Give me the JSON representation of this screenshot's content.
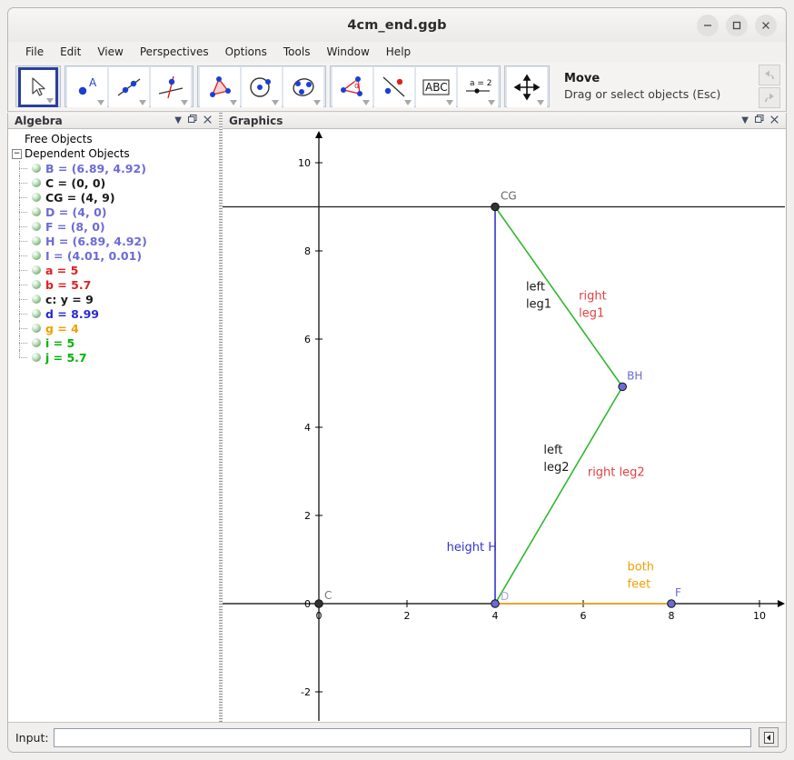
{
  "window": {
    "title": "4cm_end.ggb",
    "minimize_icon": "minimize-icon",
    "maximize_icon": "maximize-icon",
    "close_icon": "close-icon"
  },
  "menu": {
    "items": [
      {
        "label": "File"
      },
      {
        "label": "Edit"
      },
      {
        "label": "View"
      },
      {
        "label": "Perspectives"
      },
      {
        "label": "Options"
      },
      {
        "label": "Tools"
      },
      {
        "label": "Window"
      },
      {
        "label": "Help"
      }
    ]
  },
  "toolbar": {
    "tools": [
      {
        "name": "move-tool",
        "icon": "arrow-cursor-icon",
        "selected": true
      },
      {
        "name": "point-tool",
        "icon": "point-a-icon",
        "selected": false
      },
      {
        "name": "line-tool",
        "icon": "line-through-two-points-icon",
        "selected": false
      },
      {
        "name": "perpendicular-line-tool",
        "icon": "perpendicular-line-icon",
        "selected": false
      },
      {
        "name": "polygon-tool",
        "icon": "triangle-polygon-icon",
        "selected": false
      },
      {
        "name": "circle-tool",
        "icon": "circle-center-point-icon",
        "selected": false
      },
      {
        "name": "conic-tool",
        "icon": "ellipse-three-points-icon",
        "selected": false
      },
      {
        "name": "angle-tool",
        "icon": "angle-measure-icon",
        "selected": false
      },
      {
        "name": "reflect-tool",
        "icon": "reflect-about-line-icon",
        "selected": false
      },
      {
        "name": "text-tool",
        "icon": "abc-text-icon",
        "selected": false
      },
      {
        "name": "slider-tool",
        "icon": "slider-a-equals-2-icon",
        "selected": false
      },
      {
        "name": "move-graphics-tool",
        "icon": "move-graphics-view-icon",
        "selected": false
      }
    ],
    "active_tool_name": "Move",
    "active_tool_hint": "Drag or select objects (Esc)",
    "undo_icon": "undo-arrow-icon",
    "redo_icon": "redo-arrow-icon"
  },
  "algebra_panel": {
    "title": "Algebra",
    "header_icons": [
      "chevron-down-icon",
      "restore-icon",
      "close-icon"
    ],
    "groups": [
      {
        "label": "Free Objects",
        "expandable": false,
        "children": []
      },
      {
        "label": "Dependent Objects",
        "expandable": true,
        "expander_glyph": "−",
        "children": [
          {
            "text": "B = (6.89, 4.92)",
            "color": "#6b6bd6"
          },
          {
            "text": "C = (0, 0)",
            "color": "#1a1a1a"
          },
          {
            "text": "CG = (4, 9)",
            "color": "#1a1a1a"
          },
          {
            "text": "D = (4, 0)",
            "color": "#6b6bd6"
          },
          {
            "text": "F = (8, 0)",
            "color": "#6b6bd6"
          },
          {
            "text": "H = (6.89, 4.92)",
            "color": "#6b6bd6"
          },
          {
            "text": "I = (4.01, 0.01)",
            "color": "#6b6bd6"
          },
          {
            "text": "a = 5",
            "color": "#e02020"
          },
          {
            "text": "b = 5.7",
            "color": "#e02020"
          },
          {
            "text": "c: y = 9",
            "color": "#1a1a1a"
          },
          {
            "text": "d = 8.99",
            "color": "#2a2ad0"
          },
          {
            "text": "g = 4",
            "color": "#f0a000"
          },
          {
            "text": "i = 5",
            "color": "#00b400"
          },
          {
            "text": "j = 5.7",
            "color": "#00b400"
          }
        ]
      }
    ]
  },
  "graphics_panel": {
    "title": "Graphics",
    "header_icons": [
      "chevron-down-icon",
      "restore-icon",
      "close-icon"
    ]
  },
  "input_bar": {
    "label": "Input:",
    "value": "",
    "placeholder": "",
    "side_button_icon": "collapse-left-icon"
  },
  "colors": {
    "green_segment": "#2eb82e",
    "blue_segment": "#3333cc",
    "orange_segment": "#f0a000",
    "red_label": "#e04040",
    "black_label": "#1a1a1a",
    "point_blue": "#6b6bd6",
    "point_black": "#333333",
    "axis": "#000000"
  },
  "chart_data": {
    "type": "scatter",
    "title": "",
    "xlabel": "",
    "ylabel": "",
    "xlim": [
      -2.2,
      10.7
    ],
    "ylim": [
      -2.9,
      10.9
    ],
    "grid": false,
    "xticks": [
      0,
      2,
      4,
      6,
      8,
      10
    ],
    "yticks": [
      -2,
      0,
      2,
      4,
      6,
      8,
      10
    ],
    "points": [
      {
        "name": "C",
        "x": 0,
        "y": 0,
        "label": "C",
        "color": "#333333",
        "label_color": "#666666"
      },
      {
        "name": "CG",
        "x": 4,
        "y": 9,
        "label": "CG",
        "color": "#333333",
        "label_color": "#666666"
      },
      {
        "name": "D",
        "x": 4,
        "y": 0,
        "label": "D",
        "color": "#6b6bd6",
        "label_color": "#9a9ae0"
      },
      {
        "name": "F",
        "x": 8,
        "y": 0,
        "label": "F",
        "color": "#6b6bd6",
        "label_color": "#6b6bd6"
      },
      {
        "name": "BH",
        "x": 6.89,
        "y": 4.92,
        "label": "BH",
        "color": "#6b6bd6",
        "label_color": "#6b6bd6"
      }
    ],
    "segments": [
      {
        "name": "right leg1",
        "x1": 4,
        "y1": 9,
        "x2": 6.89,
        "y2": 4.92,
        "color": "#2eb82e"
      },
      {
        "name": "right leg2",
        "x1": 6.89,
        "y1": 4.92,
        "x2": 4,
        "y2": 0,
        "color": "#2eb82e"
      },
      {
        "name": "height H",
        "x1": 4,
        "y1": 9,
        "x2": 4,
        "y2": 0,
        "color": "#3333cc"
      },
      {
        "name": "both feet",
        "x1": 4,
        "y1": 0,
        "x2": 8,
        "y2": 0,
        "color": "#f0a000"
      }
    ],
    "lines": [
      {
        "name": "c: y = 9",
        "y": 9,
        "color": "#1a1a1a"
      }
    ],
    "annotations": [
      {
        "text_lines": [
          "left",
          "leg1"
        ],
        "x": 4.7,
        "y": 7.1,
        "color": "#1a1a1a"
      },
      {
        "text_lines": [
          "right",
          "leg1"
        ],
        "x": 5.9,
        "y": 6.9,
        "color": "#e04040"
      },
      {
        "text_lines": [
          "left",
          "leg2"
        ],
        "x": 5.1,
        "y": 3.4,
        "color": "#1a1a1a"
      },
      {
        "text_lines": [
          "right leg2"
        ],
        "x": 6.1,
        "y": 2.9,
        "color": "#e04040"
      },
      {
        "text_lines": [
          "height H"
        ],
        "x": 2.9,
        "y": 1.2,
        "color": "#3333cc"
      },
      {
        "text_lines": [
          "both",
          "feet"
        ],
        "x": 7.0,
        "y": 0.75,
        "color": "#f0a000"
      }
    ]
  }
}
